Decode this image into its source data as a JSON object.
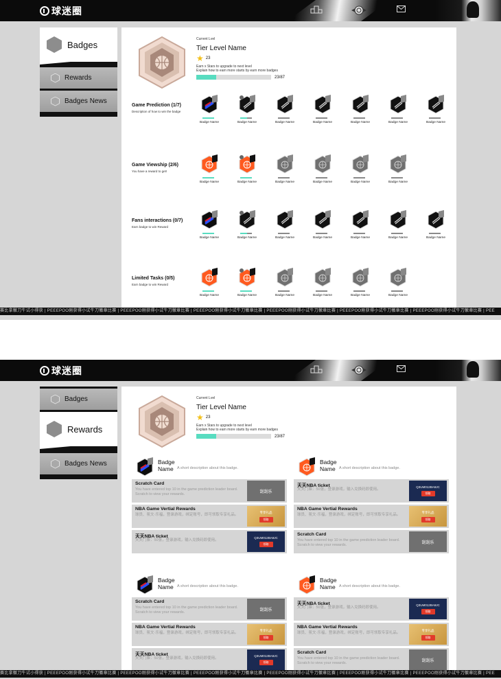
{
  "brand": {
    "logo_text": "球迷圈"
  },
  "nav": {
    "mail_icon": "mail-icon",
    "ranking_icon": "podium-icon",
    "home_icon": "emblem-icon"
  },
  "sidebar1": {
    "active": "Badges",
    "items": [
      {
        "label": "Badges",
        "icon": "hexagon-icon"
      },
      {
        "label": "Rewards",
        "icon": "hexagon-icon"
      },
      {
        "label": "Badges News",
        "icon": "hexagon-icon"
      }
    ]
  },
  "sidebar2": {
    "active": "Rewards",
    "items": [
      {
        "label": "Badges",
        "icon": "hexagon-icon"
      },
      {
        "label": "Rewards",
        "icon": "hexagon-icon"
      },
      {
        "label": "Badges News",
        "icon": "hexagon-icon"
      }
    ]
  },
  "tier": {
    "current_label": "Current Lvel",
    "name": "Tier Level Name",
    "stars": "23",
    "hint_1": "Earn x Stars to upgrade to next level",
    "hint_2": "Explain how to earn more starts by earn more badges",
    "progress_text": "23/87",
    "progress_fraction": 0.264
  },
  "categories": [
    {
      "title": "Game Prediction (1/7)",
      "desc": "Description of how to win the badge",
      "style": "dark",
      "badges": [
        {
          "name": "Badge Name",
          "state": "earned-color",
          "progress": 1.0
        },
        {
          "name": "Badge Name",
          "state": "dark-count",
          "progress": 0.6
        },
        {
          "name": "Badge Name",
          "state": "dark",
          "progress": 0
        },
        {
          "name": "Badge Name",
          "state": "dark",
          "progress": 0
        },
        {
          "name": "Badge Name",
          "state": "dark",
          "progress": 0
        },
        {
          "name": "Badge Name",
          "state": "dark",
          "progress": 0
        },
        {
          "name": "Badge Name",
          "state": "dark",
          "progress": 0
        }
      ]
    },
    {
      "title": "Game Viewship (2/6)",
      "desc": "You have a reward to get!",
      "style": "orange",
      "badges": [
        {
          "name": "Badge Name",
          "state": "orange",
          "progress": 1.0
        },
        {
          "name": "Badge Name",
          "state": "orange-count",
          "progress": 1.0
        },
        {
          "name": "Badge Name",
          "state": "grey",
          "progress": 0
        },
        {
          "name": "Badge Name",
          "state": "grey",
          "progress": 0
        },
        {
          "name": "Badge Name",
          "state": "grey",
          "progress": 0
        },
        {
          "name": "Badge Name",
          "state": "grey",
          "progress": 0
        }
      ]
    },
    {
      "title": "Fans interactions (0/7)",
      "desc": "Earn badge to win Reward",
      "style": "dark",
      "badges": [
        {
          "name": "Badge Name",
          "state": "earned-color",
          "progress": 1.0
        },
        {
          "name": "Badge Name",
          "state": "dark-count",
          "progress": 0.6
        },
        {
          "name": "Badge Name",
          "state": "dark",
          "progress": 0
        },
        {
          "name": "Badge Name",
          "state": "dark",
          "progress": 0
        },
        {
          "name": "Badge Name",
          "state": "dark",
          "progress": 0
        },
        {
          "name": "Badge Name",
          "state": "dark",
          "progress": 0
        },
        {
          "name": "Badge Name",
          "state": "dark",
          "progress": 0
        }
      ]
    },
    {
      "title": "Limited Tasks (0/5)",
      "desc": "Earn badge to win Reward",
      "style": "orange",
      "badges": [
        {
          "name": "Badge Name",
          "state": "orange",
          "progress": 1.0
        },
        {
          "name": "Badge Name",
          "state": "orange-count",
          "progress": 1.0
        },
        {
          "name": "Badge Name",
          "state": "grey",
          "progress": 0
        },
        {
          "name": "Badge Name",
          "state": "grey",
          "progress": 0
        },
        {
          "name": "Badge Name",
          "state": "grey",
          "progress": 0
        },
        {
          "name": "Badge Name",
          "state": "grey",
          "progress": 0
        }
      ]
    }
  ],
  "ticker_text": "赛比拿徽刀牛试小得获 | PEEEPOO刚获得小试牛刀徽章比赛 | PEEEPOO刚获得小试牛刀徽章比赛 | PEEEPOO刚获得小试牛刀徽章比赛 | PEEEPOO刚获得小试牛刀徽章比赛 | PEEEPOO刚获得小试牛刀徽章比赛 | PEEEPOO刚获得小试牛刀徽章比赛 | PEE",
  "ticker_text_2": "赛比拿徽刀牛试小得获 | PEEEPOO刚获得小试牛刀徽章比赛 | PEEEPOO刚获得小试牛刀徽章比赛 | PEEEPOO刚获得小试牛刀徽章比赛 | PEEEPOO刚获得小试牛刀徽章比赛 | PEEEPOO刚获得小试牛刀徽章比赛 | PEEEPOO刚获得小试牛刀徽章比赛 | PEE",
  "reward_groups": [
    {
      "badge_name": "Badge Name",
      "badge_style": "dark",
      "desc": "A short description about this badge.",
      "cards": [
        {
          "title": "Scratch Card",
          "desc": "You have entered top 10 in the game prediction leader board. Scratch to view your rewards.",
          "thumb": "scratch",
          "thumb_text": "刮刮乐",
          "btn": ""
        },
        {
          "title": "NBA Game Vertial Rewards",
          "desc": "球员、氛文·乐福，登录游戏，绑定账号，即可领取专享礼品。",
          "thumb": "gold",
          "thumb_text": "专享礼品",
          "btn": "领取"
        },
        {
          "title": "天天NBA ticket",
          "desc": "天天门票：50张，登录游戏，输入兑换码即使用。",
          "thumb": "navy",
          "thumb_text": "Q3UM012BA9JC",
          "btn": "领取"
        }
      ]
    },
    {
      "badge_name": "Badge Name",
      "badge_style": "orange",
      "desc": "A short description about this badge.",
      "cards": [
        {
          "title": "天天NBA ticket",
          "desc": "天天门票：50张，登录游戏，输入兑换码即使用。",
          "thumb": "navy",
          "thumb_text": "Q3UM012BA9JC",
          "btn": "领取"
        },
        {
          "title": "NBA Game Vertial Rewards",
          "desc": "球员、氛文·乐福，登录游戏，绑定账号，即可领取专享礼品。",
          "thumb": "gold",
          "thumb_text": "专享礼品",
          "btn": "领取"
        },
        {
          "title": "Scratch Card",
          "desc": "You have entered top 10 in the game prediction leader board. Scratch to view your rewards.",
          "thumb": "scratch",
          "thumb_text": "刮刮乐",
          "btn": ""
        }
      ]
    },
    {
      "badge_name": "Badge Name",
      "badge_style": "dark",
      "desc": "A short description about this badge.",
      "cards": [
        {
          "title": "Scratch Card",
          "desc": "You have entered top 10 in the game prediction leader board. Scratch to view your rewards.",
          "thumb": "scratch",
          "thumb_text": "刮刮乐",
          "btn": ""
        },
        {
          "title": "NBA Game Vertial Rewards",
          "desc": "球员、氛文·乐福，登录游戏，绑定账号，即可领取专享礼品。",
          "thumb": "gold",
          "thumb_text": "专享礼品",
          "btn": "领取"
        },
        {
          "title": "天天NBA ticket",
          "desc": "天天门票：50张，登录游戏，输入兑换码即使用。",
          "thumb": "navy",
          "thumb_text": "Q3UM012BA9JC",
          "btn": "领取"
        }
      ]
    },
    {
      "badge_name": "Badge Name",
      "badge_style": "orange",
      "desc": "A short description about this badge.",
      "cards": [
        {
          "title": "天天NBA ticket",
          "desc": "天天门票：50张，登录游戏，输入兑换码即使用。",
          "thumb": "navy",
          "thumb_text": "Q3UM012BA9JC",
          "btn": "领取"
        },
        {
          "title": "NBA Game Vertial Rewards",
          "desc": "球员、氛文·乐福，登录游戏，绑定账号，即可领取专享礼品。",
          "thumb": "gold",
          "thumb_text": "专享礼品",
          "btn": "领取"
        },
        {
          "title": "Scratch Card",
          "desc": "You have entered top 10 in the game prediction leader board. Scratch to view your rewards.",
          "thumb": "scratch",
          "thumb_text": "刮刮乐",
          "btn": ""
        }
      ]
    }
  ],
  "colors": {
    "accent": "#58dcc0",
    "star": "#f3c01b",
    "orange_badge": "#ff5a1f",
    "panel_bg": "#d6d6d6"
  }
}
